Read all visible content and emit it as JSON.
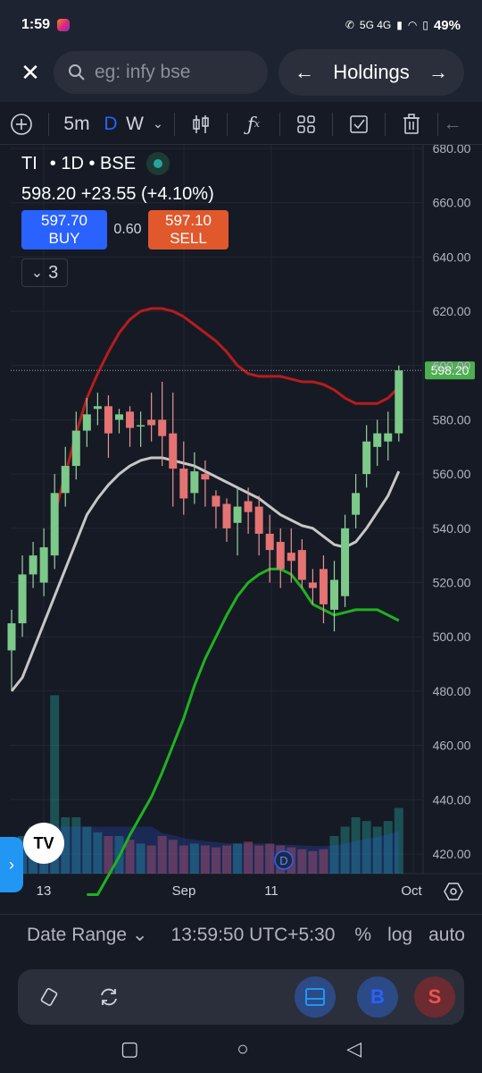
{
  "status": {
    "time": "1:59",
    "network": "5G 4G",
    "battery": "49%",
    "icons": [
      "instagram-icon",
      "call-icon",
      "signal-icon",
      "wifi-icon",
      "battery-icon"
    ]
  },
  "header": {
    "search_placeholder": "eg: infy bse",
    "watchlist_label": "Holdings"
  },
  "toolbar": {
    "interval": "5m",
    "range_d": "D",
    "range_w": "W"
  },
  "legend": {
    "symbol": "TI",
    "meta": "• 1D • BSE",
    "price_line": "598.20 +23.55 (+4.10%)",
    "buy_price": "597.70",
    "buy_label": "BUY",
    "spread": "0.60",
    "sell_price": "597.10",
    "sell_label": "SELL",
    "indicators_count": "3"
  },
  "colors": {
    "up": "#26a69a",
    "down": "#ef5350",
    "bb_upper": "#b71c1c",
    "bb_mid": "#c7c7c7",
    "bb_lower": "#1eb31e",
    "price_label_bg": "#4caf50",
    "accent": "#2962ff",
    "sell": "#e0582c"
  },
  "chart_data": {
    "type": "candlestick",
    "symbol": "TI",
    "exchange": "BSE",
    "interval": "1D",
    "y_ticks": [
      "680.00",
      "660.00",
      "640.00",
      "620.00",
      "600.00",
      "580.00",
      "560.00",
      "540.00",
      "520.00",
      "500.00",
      "480.00",
      "460.00",
      "440.00",
      "420.00"
    ],
    "ylim": [
      416,
      682
    ],
    "x_ticks": [
      "13",
      "Sep",
      "11",
      "Oct"
    ],
    "last_price_label": "598.20",
    "last_price": 598.2,
    "candles": [
      {
        "o": 495,
        "h": 510,
        "c": 505,
        "l": 480
      },
      {
        "o": 505,
        "h": 530,
        "c": 523,
        "l": 500
      },
      {
        "o": 523,
        "h": 535,
        "c": 530,
        "l": 518
      },
      {
        "o": 520,
        "h": 540,
        "c": 533,
        "l": 515
      },
      {
        "o": 530,
        "h": 560,
        "c": 553,
        "l": 525
      },
      {
        "o": 553,
        "h": 570,
        "c": 563,
        "l": 548
      },
      {
        "o": 563,
        "h": 583,
        "c": 576,
        "l": 558
      },
      {
        "o": 576,
        "h": 588,
        "c": 582,
        "l": 570
      },
      {
        "o": 584,
        "h": 590,
        "c": 585,
        "l": 578
      },
      {
        "o": 585,
        "h": 589,
        "c": 575,
        "l": 566
      },
      {
        "o": 580,
        "h": 584,
        "c": 582,
        "l": 575
      },
      {
        "o": 583,
        "h": 585,
        "c": 577,
        "l": 570
      },
      {
        "o": 578,
        "h": 583,
        "c": 578,
        "l": 570
      },
      {
        "o": 580,
        "h": 590,
        "c": 578,
        "l": 572
      },
      {
        "o": 580,
        "h": 594,
        "c": 574,
        "l": 563
      },
      {
        "o": 575,
        "h": 590,
        "c": 562,
        "l": 548
      },
      {
        "o": 562,
        "h": 572,
        "c": 551,
        "l": 545
      },
      {
        "o": 553,
        "h": 568,
        "c": 561,
        "l": 549
      },
      {
        "o": 560,
        "h": 565,
        "c": 558,
        "l": 548
      },
      {
        "o": 552,
        "h": 554,
        "c": 548,
        "l": 540
      },
      {
        "o": 549,
        "h": 551,
        "c": 540,
        "l": 535
      },
      {
        "o": 542,
        "h": 555,
        "c": 548,
        "l": 530
      },
      {
        "o": 550,
        "h": 555,
        "c": 546,
        "l": 538
      },
      {
        "o": 548,
        "h": 552,
        "c": 538,
        "l": 530
      },
      {
        "o": 538,
        "h": 545,
        "c": 532,
        "l": 520
      },
      {
        "o": 535,
        "h": 540,
        "c": 525,
        "l": 518
      },
      {
        "o": 531,
        "h": 540,
        "c": 528,
        "l": 520
      },
      {
        "o": 532,
        "h": 536,
        "c": 521,
        "l": 518
      },
      {
        "o": 520,
        "h": 525,
        "c": 518,
        "l": 512
      },
      {
        "o": 525,
        "h": 530,
        "c": 512,
        "l": 505
      },
      {
        "o": 510,
        "h": 528,
        "c": 521,
        "l": 502
      },
      {
        "o": 515,
        "h": 545,
        "c": 540,
        "l": 511
      },
      {
        "o": 545,
        "h": 560,
        "c": 553,
        "l": 540
      },
      {
        "o": 560,
        "h": 578,
        "c": 572,
        "l": 555
      },
      {
        "o": 570,
        "h": 580,
        "c": 575,
        "l": 563
      },
      {
        "o": 572,
        "h": 583,
        "c": 575,
        "l": 565
      },
      {
        "o": 575,
        "h": 600,
        "c": 598.2,
        "l": 572
      }
    ],
    "bb_upper": [
      null,
      null,
      null,
      null,
      545,
      560,
      575,
      588,
      597,
      605,
      612,
      617,
      620,
      621,
      621,
      620,
      618,
      615,
      612,
      609,
      605,
      600,
      597,
      596,
      596,
      596,
      595,
      594,
      594,
      593,
      591,
      588,
      586,
      586,
      586,
      588,
      592
    ],
    "bb_mid": [
      480,
      485,
      495,
      505,
      515,
      525,
      535,
      545,
      551,
      556,
      560,
      563,
      565,
      566,
      566,
      565,
      564,
      563,
      561,
      559,
      557,
      555,
      553,
      551,
      548,
      545,
      543,
      541,
      540,
      537,
      534,
      533,
      535,
      540,
      546,
      552,
      561
    ],
    "bb_lower": [
      null,
      null,
      null,
      null,
      null,
      null,
      null,
      398,
      404,
      412,
      419,
      427,
      434,
      441,
      450,
      460,
      470,
      482,
      492,
      500,
      508,
      515,
      520,
      523,
      525,
      525,
      523,
      518,
      512,
      510,
      508,
      509,
      510,
      510,
      510,
      508,
      506
    ],
    "volume": [
      0.15,
      0.2,
      0.25,
      0.2,
      0.95,
      0.3,
      0.3,
      0.25,
      0.22,
      0.2,
      0.2,
      0.18,
      0.16,
      0.15,
      0.2,
      0.18,
      0.15,
      0.16,
      0.15,
      0.14,
      0.15,
      0.16,
      0.17,
      0.15,
      0.16,
      0.15,
      0.14,
      0.13,
      0.12,
      0.13,
      0.2,
      0.25,
      0.3,
      0.28,
      0.25,
      0.28,
      0.35
    ]
  },
  "info_bar": {
    "date_range": "Date Range ⌄",
    "time": "13:59:50 UTC+5:30",
    "percent": "%",
    "log": "log",
    "auto": "auto"
  },
  "actions": {
    "buy_short": "B",
    "sell_short": "S"
  }
}
